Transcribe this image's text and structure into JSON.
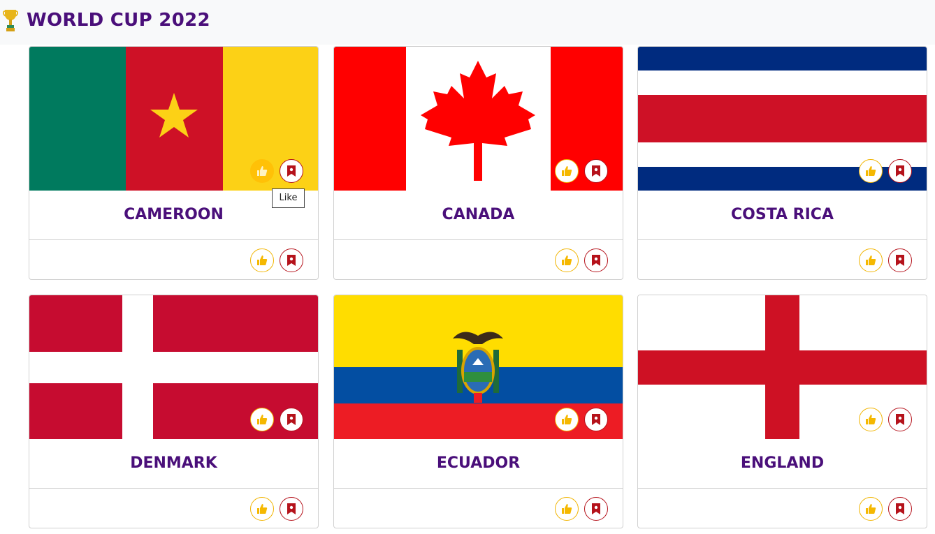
{
  "app": {
    "title": "WORLD CUP 2022",
    "logo_icon": "trophy-icon"
  },
  "colors": {
    "brand": "#4a0f7a",
    "like": "#ffc107",
    "save": "#b5121b"
  },
  "tooltip": {
    "text": "Like"
  },
  "teams": [
    {
      "name": "CAMEROON",
      "flag": "cameroon-flag",
      "like_icon": "thumbs-up-icon",
      "save_icon": "bookmark-icon"
    },
    {
      "name": "CANADA",
      "flag": "canada-flag",
      "like_icon": "thumbs-up-icon",
      "save_icon": "bookmark-icon"
    },
    {
      "name": "COSTA RICA",
      "flag": "costa-rica-flag",
      "like_icon": "thumbs-up-icon",
      "save_icon": "bookmark-icon"
    },
    {
      "name": "DENMARK",
      "flag": "denmark-flag",
      "like_icon": "thumbs-up-icon",
      "save_icon": "bookmark-icon"
    },
    {
      "name": "ECUADOR",
      "flag": "ecuador-flag",
      "like_icon": "thumbs-up-icon",
      "save_icon": "bookmark-icon"
    },
    {
      "name": "ENGLAND",
      "flag": "england-flag",
      "like_icon": "thumbs-up-icon",
      "save_icon": "bookmark-icon"
    }
  ]
}
